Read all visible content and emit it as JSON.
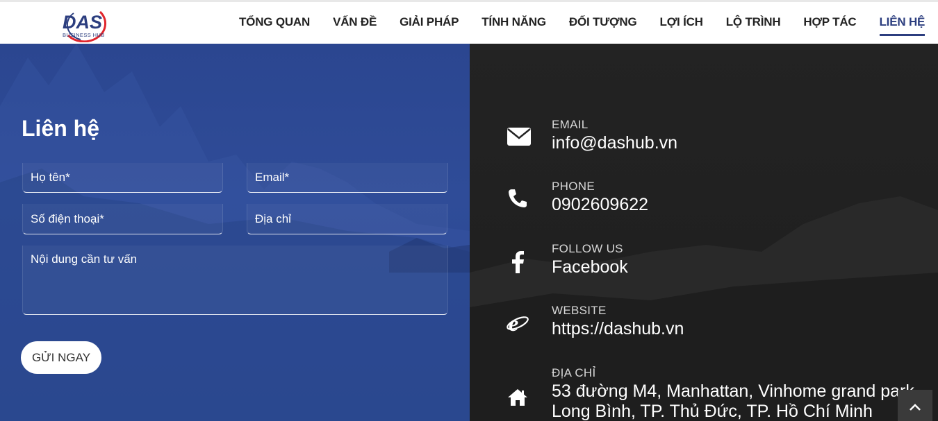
{
  "header": {
    "logo_text": "DAS",
    "logo_subtext": "BUSINESS HUB",
    "nav": [
      {
        "label": "TỔNG QUAN",
        "active": false
      },
      {
        "label": "VẤN ĐỀ",
        "active": false
      },
      {
        "label": "GIẢI PHÁP",
        "active": false
      },
      {
        "label": "TÍNH NĂNG",
        "active": false
      },
      {
        "label": "ĐỐI TƯỢNG",
        "active": false
      },
      {
        "label": "LỢI ÍCH",
        "active": false
      },
      {
        "label": "LỘ TRÌNH",
        "active": false
      },
      {
        "label": "HỢP TÁC",
        "active": false
      },
      {
        "label": "LIÊN HỆ",
        "active": true
      }
    ]
  },
  "form": {
    "title": "Liên hệ",
    "name_placeholder": "Họ tên*",
    "email_placeholder": "Email*",
    "phone_placeholder": "Số điện thoại*",
    "address_placeholder": "Địa chỉ",
    "message_placeholder": "Nội dung cần tư vấn",
    "submit_label": "GỬI NGAY"
  },
  "contact": {
    "email_label": "EMAIL",
    "email_value": "info@dashub.vn",
    "phone_label": "PHONE",
    "phone_value": "0902609622",
    "follow_label": "FOLLOW US",
    "follow_value": "Facebook",
    "website_label": "WEBSITE",
    "website_value": "https://dashub.vn",
    "address_label": "ĐỊA CHỈ",
    "address_line1": "53 đường M4, Manhattan, Vinhome grand park,",
    "address_line2": "Long Bình, TP. Thủ Đức, TP. Hồ Chí Minh"
  },
  "colors": {
    "brand_blue": "#2c3e7f",
    "brand_red": "#e0262d",
    "left_panel": "#2f4c98",
    "right_panel": "#1f1f1f"
  }
}
